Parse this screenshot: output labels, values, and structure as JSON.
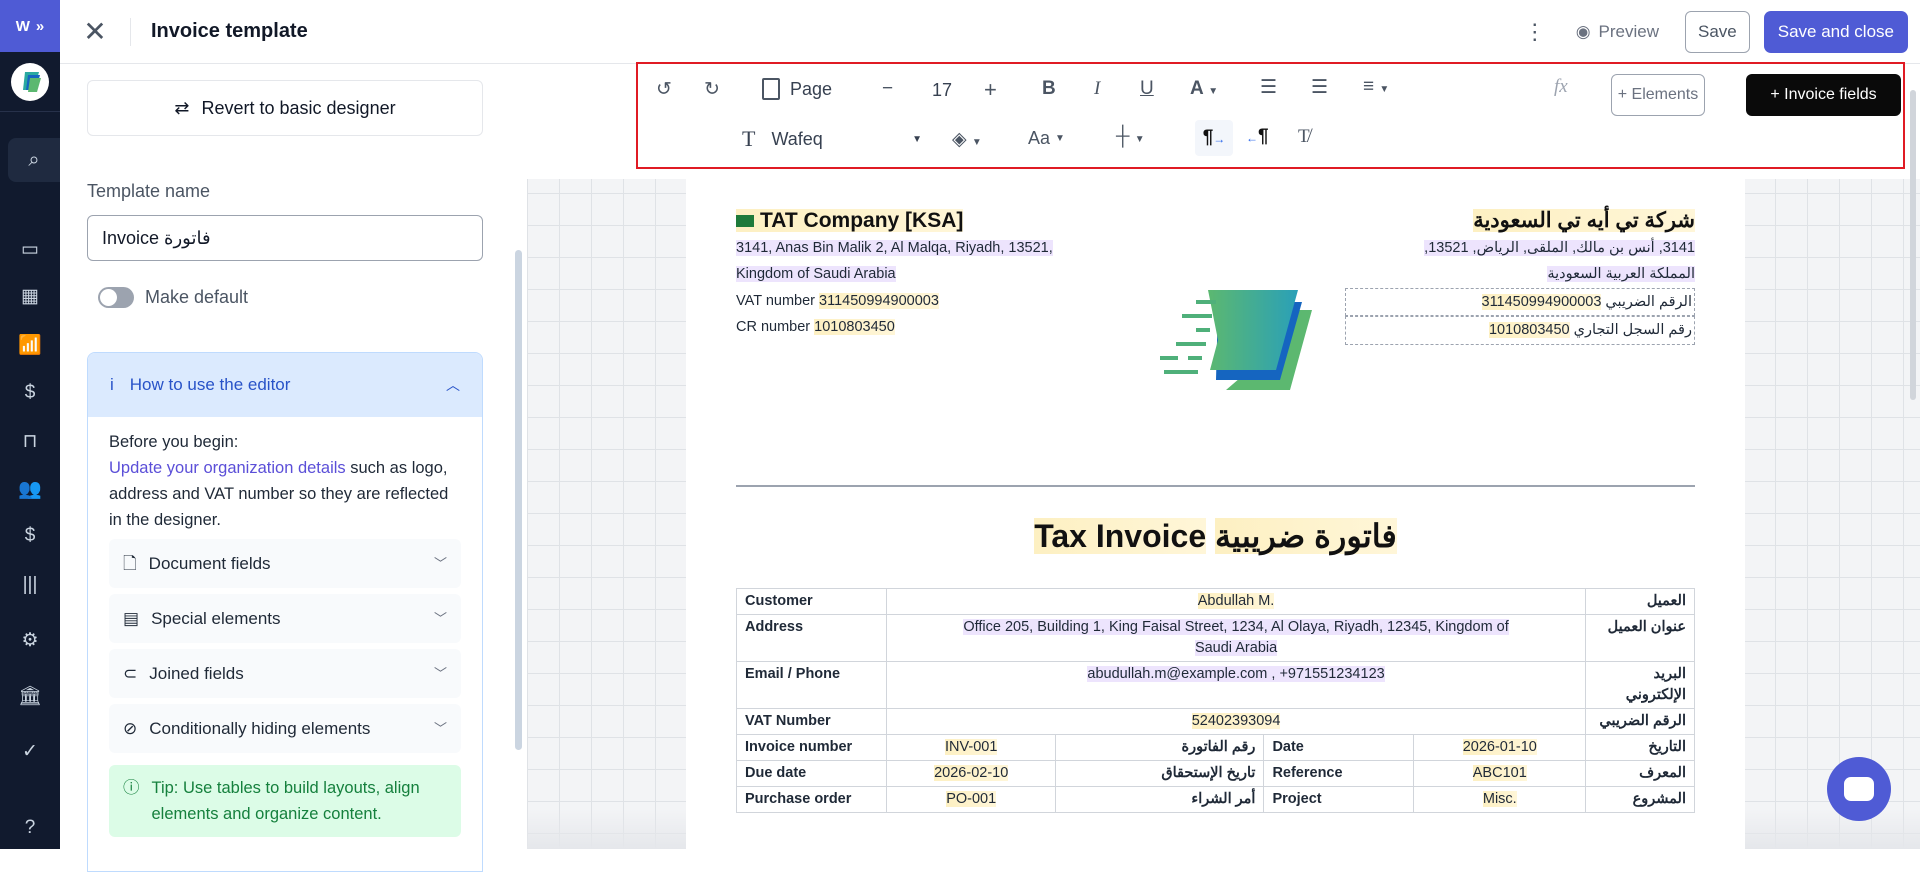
{
  "header": {
    "title": "Invoice template",
    "preview_label": "Preview",
    "save_label": "Save",
    "save_close_label": "Save and close"
  },
  "left_panel": {
    "revert_label": "Revert to basic designer",
    "template_name_label": "Template name",
    "template_name_value": "Invoice فاتورة",
    "make_default_label": "Make default",
    "make_default_on": false,
    "howto": {
      "title": "How to use the editor",
      "before": "Before you begin:",
      "link": "Update your organization details",
      "rest": " such as logo, address and VAT number so they are reflected in the designer.",
      "items": [
        {
          "label": "Document fields",
          "icon": "file-icon"
        },
        {
          "label": "Special elements",
          "icon": "list-icon"
        },
        {
          "label": "Joined fields",
          "icon": "link-icon"
        },
        {
          "label": "Conditionally hiding elements",
          "icon": "eye-off-icon"
        }
      ],
      "tip": "Tip: Use tables to build layouts, align elements and organize content."
    }
  },
  "toolbar": {
    "page_label": "Page",
    "font_size": "17",
    "font_name": "Wafeq",
    "case_label": "Aa",
    "fx_label": "fx",
    "elements_label": "+ Elements",
    "invoice_fields_label": "+  Invoice fields"
  },
  "invoice": {
    "company_en": "TAT Company [KSA]",
    "address_en_1": "3141, Anas Bin Malik 2, Al Malqa, Riyadh, 13521,",
    "address_en_2": "Kingdom of Saudi Arabia",
    "vat_label_en": "VAT number",
    "vat_value": "311450994900003",
    "cr_label_en": "CR number",
    "cr_value": "1010803450",
    "company_ar": "شركة تي أيه تي السعودية",
    "address_ar_1": "3141, أنس بن مالك, الملقى, الرياض, 13521,",
    "address_ar_2": "المملكة العربية السعودية",
    "vat_label_ar": "الرقم الضريبي",
    "cr_label_ar": "رقم السجل التجاري",
    "title_en": "Tax Invoice",
    "title_ar": "فاتورة ضريبية",
    "rows": [
      {
        "en": "Customer",
        "value": "Abdullah M.",
        "ar": "العميل"
      },
      {
        "en": "Address",
        "value": "Office 205, Building 1, King Faisal Street, 1234, Al Olaya, Riyadh, 12345, Kingdom of Saudi Arabia",
        "ar": "عنوان العميل"
      },
      {
        "en": "Email / Phone",
        "value": "abudullah.m@example.com , +971551234123",
        "ar": "البريد الإلكتروني"
      },
      {
        "en": "VAT Number",
        "value": "52402393094",
        "ar": "الرقم الضريبي"
      }
    ],
    "grid_rows": [
      {
        "en1": "Invoice number",
        "v1": "INV-001",
        "ar1": "رقم الفاتورة",
        "en2": "Date",
        "v2": "2026-01-10",
        "ar2": "التاريخ"
      },
      {
        "en1": "Due date",
        "v1": "2026-02-10",
        "ar1": "تاريخ الإستحقاق",
        "en2": "Reference",
        "v2": "ABC101",
        "ar2": "المعرف"
      },
      {
        "en1": "Purchase order",
        "v1": "PO-001",
        "ar1": "أمر الشراء",
        "en2": "Project",
        "v2": "Misc.",
        "ar2": "المشروع"
      }
    ]
  },
  "colors": {
    "accent": "#4f5bd5",
    "rail": "#111a2e",
    "highlight_box": "#e01b24"
  }
}
